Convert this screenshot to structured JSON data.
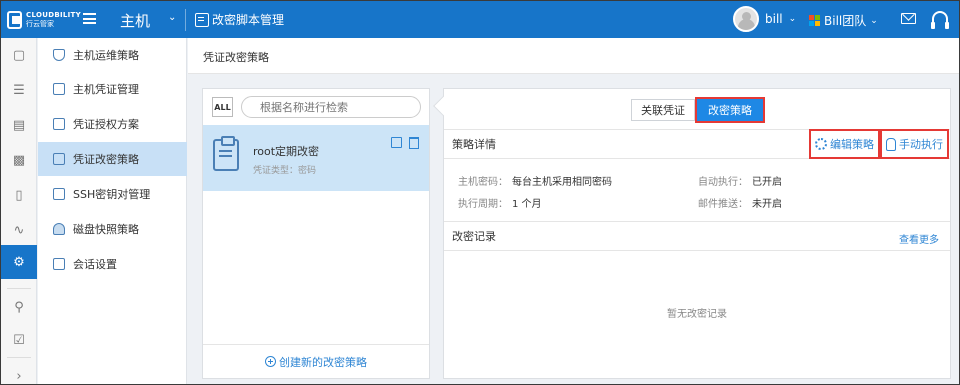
{
  "topbar": {
    "logo_line1": "CLOUDBILITY",
    "logo_line2": "行云管家",
    "module": "主机",
    "breadcrumb": "改密脚本管理",
    "user_name": "bill",
    "team_name": "Bill团队",
    "brand_color": "#1775c9"
  },
  "rail": {
    "icons": [
      "monitor-icon",
      "hierarchy-icon",
      "inbox-icon",
      "clipboard-icon",
      "badge-icon",
      "activity-icon",
      "security-icon",
      "search-icon",
      "check-icon",
      "chevron-right-icon"
    ]
  },
  "sidebar": {
    "items": [
      {
        "label": "主机运维策略",
        "icon": "shield-icon"
      },
      {
        "label": "主机凭证管理",
        "icon": "monitor-icon"
      },
      {
        "label": "凭证授权方案",
        "icon": "certificate-icon"
      },
      {
        "label": "凭证改密策略",
        "icon": "key-icon"
      },
      {
        "label": "SSH密钥对管理",
        "icon": "keypair-icon"
      },
      {
        "label": "磁盘快照策略",
        "icon": "cloud-icon"
      },
      {
        "label": "会话设置",
        "icon": "window-icon"
      }
    ],
    "active_index": 3
  },
  "content": {
    "title": "凭证改密策略"
  },
  "left_panel": {
    "all_label": "ALL",
    "search_placeholder": "根据名称进行检索",
    "policy": {
      "title": "root定期改密",
      "subtitle": "凭证类型：密码"
    },
    "create_label": "创建新的改密策略"
  },
  "right_panel": {
    "tabs": [
      {
        "label": "关联凭证",
        "active": false
      },
      {
        "label": "改密策略",
        "active": true
      }
    ],
    "details_title": "策略详情",
    "edit_label": "编辑策略",
    "run_label": "手动执行",
    "fields": {
      "host_password_key": "主机密码：",
      "host_password_val": "每台主机采用相同密码",
      "auto_exec_key": "自动执行：",
      "auto_exec_val": "已开启",
      "period_key": "执行周期：",
      "period_val": "1 个月",
      "mail_key": "邮件推送：",
      "mail_val": "未开启"
    },
    "records_title": "改密记录",
    "more_label": "查看更多",
    "empty_label": "暂无改密记录"
  }
}
